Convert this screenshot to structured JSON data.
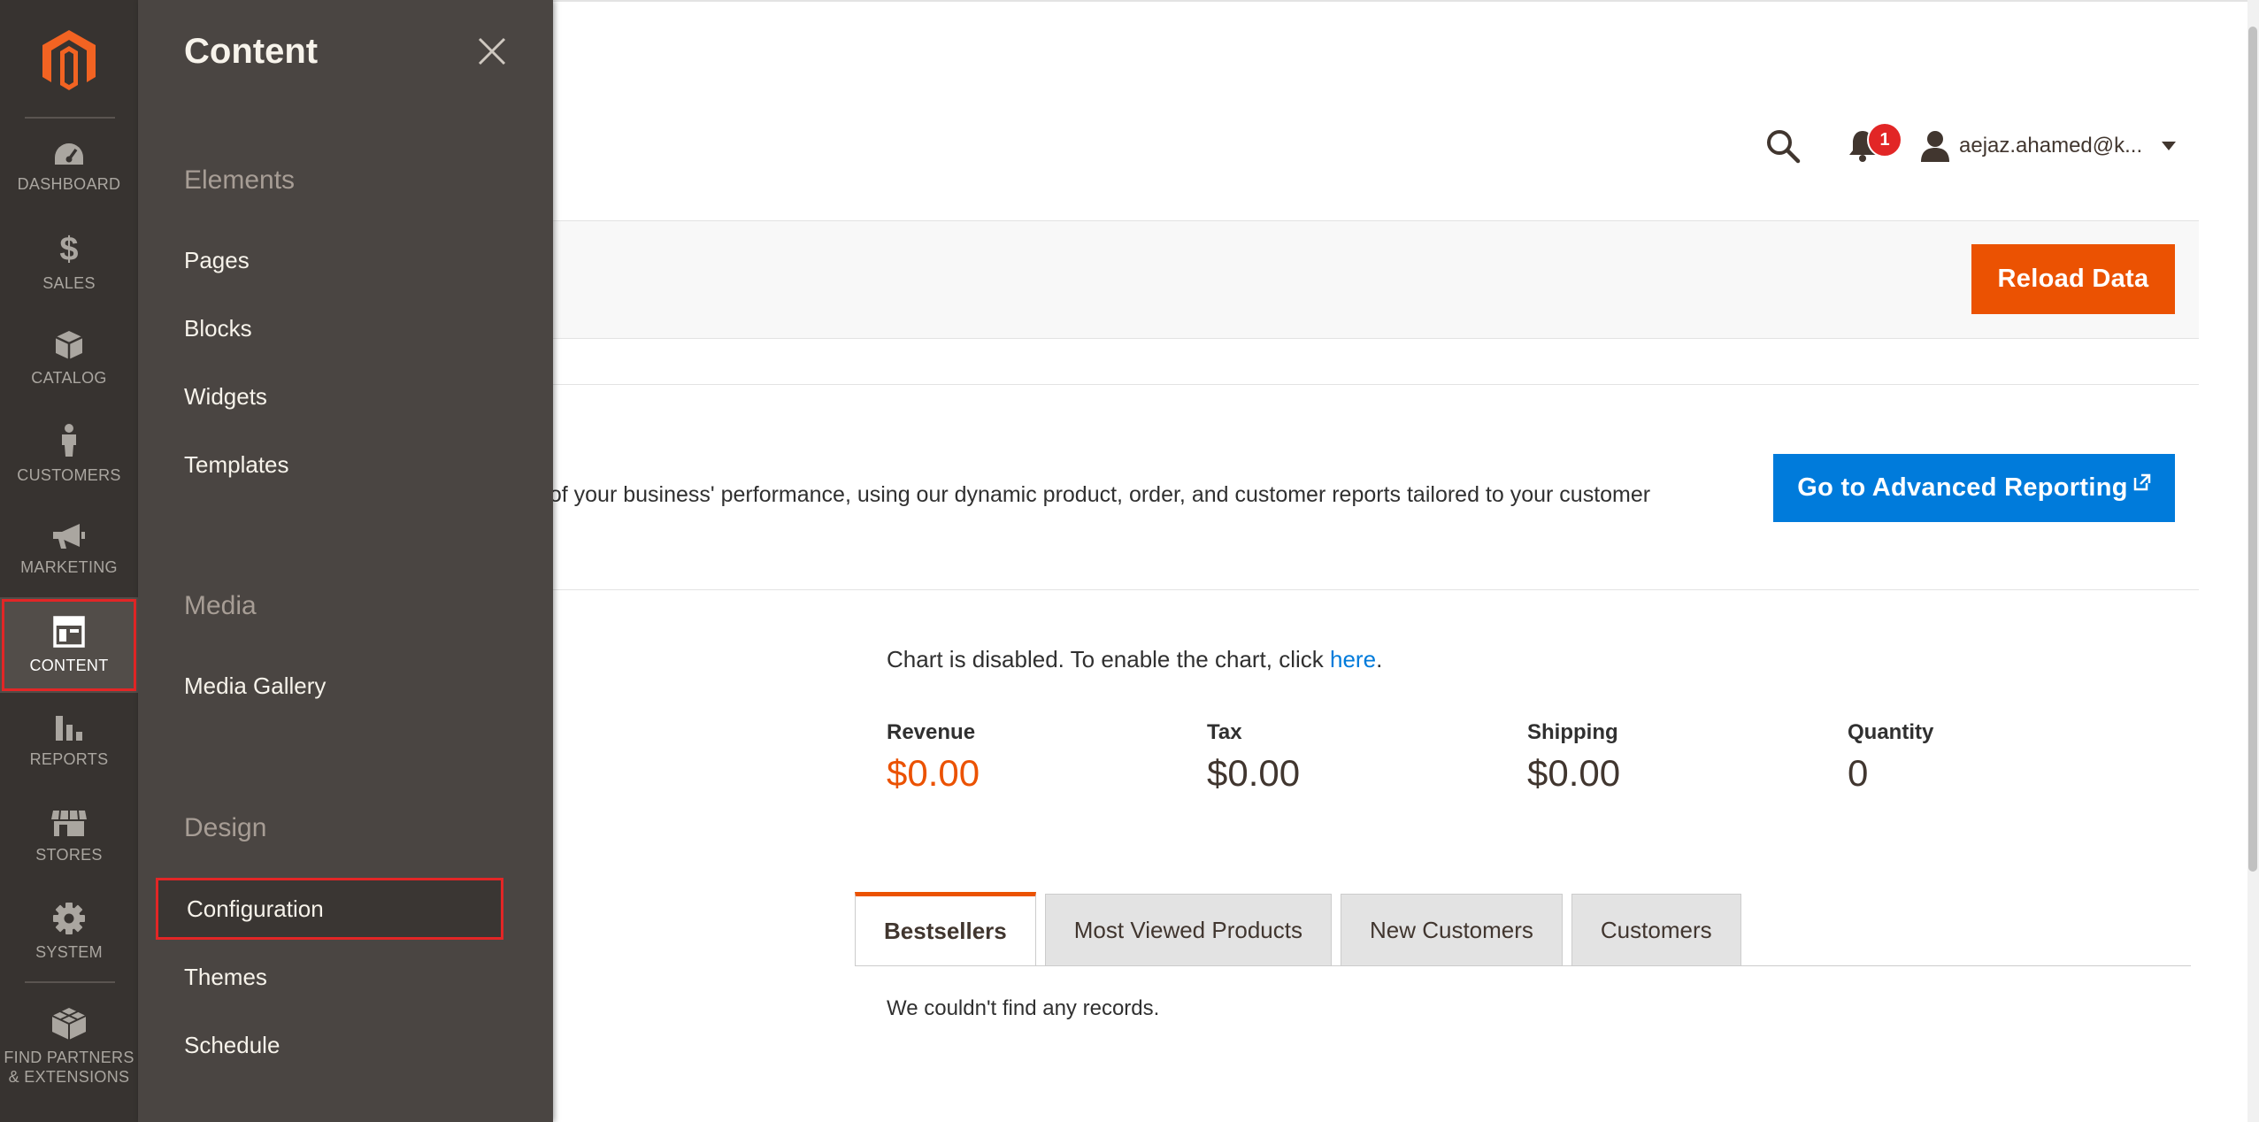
{
  "header": {
    "user_name": "aejaz.ahamed@k...",
    "notifications_count": "1"
  },
  "actions": {
    "reload_label": "Reload Data",
    "advanced_reporting_label": "Go to Advanced Reporting"
  },
  "advanced_reporting": {
    "description": "d of your business' performance, using our dynamic product, order, and customer reports tailored to your customer"
  },
  "chart": {
    "disabled_text": "Chart is disabled. To enable the chart, click ",
    "link_text": "here",
    "suffix": "."
  },
  "totals": [
    {
      "label": "Revenue",
      "value": "$0.00"
    },
    {
      "label": "Tax",
      "value": "$0.00"
    },
    {
      "label": "Shipping",
      "value": "$0.00"
    },
    {
      "label": "Quantity",
      "value": "0"
    }
  ],
  "tabs": [
    {
      "label": "Bestsellers",
      "active": true
    },
    {
      "label": "Most Viewed Products",
      "active": false
    },
    {
      "label": "New Customers",
      "active": false
    },
    {
      "label": "Customers",
      "active": false
    }
  ],
  "grid": {
    "empty_text": "We couldn't find any records."
  },
  "admin_nav": {
    "items": [
      {
        "label": "DASHBOARD",
        "icon": "dashboard-icon"
      },
      {
        "label": "SALES",
        "icon": "dollar-icon"
      },
      {
        "label": "CATALOG",
        "icon": "box-icon"
      },
      {
        "label": "CUSTOMERS",
        "icon": "person-icon"
      },
      {
        "label": "MARKETING",
        "icon": "megaphone-icon"
      },
      {
        "label": "CONTENT",
        "icon": "layout-icon",
        "active": true
      },
      {
        "label": "REPORTS",
        "icon": "bar-chart-icon"
      },
      {
        "label": "STORES",
        "icon": "store-icon"
      },
      {
        "label": "SYSTEM",
        "icon": "gear-icon"
      },
      {
        "label": "FIND PARTNERS\n& EXTENSIONS",
        "icon": "cubes-icon"
      }
    ]
  },
  "content_menu": {
    "title": "Content",
    "sections": [
      {
        "title": "Elements",
        "items": [
          "Pages",
          "Blocks",
          "Widgets",
          "Templates"
        ]
      },
      {
        "title": "Media",
        "items": [
          "Media Gallery"
        ]
      },
      {
        "title": "Design",
        "items": [
          "Configuration",
          "Themes",
          "Schedule"
        ]
      }
    ]
  },
  "colors": {
    "accent_orange": "#eb5202",
    "link_blue": "#007bdb",
    "nav_bg": "#373330",
    "submenu_bg": "#4a4542",
    "highlight_red": "#e22626"
  }
}
